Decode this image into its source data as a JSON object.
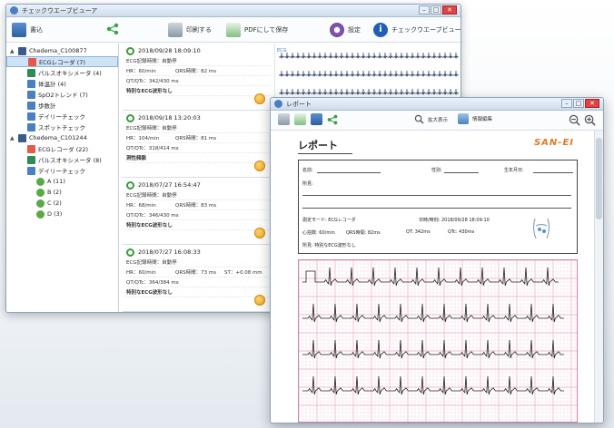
{
  "main_window": {
    "title": "チェックウエーブビューア",
    "toolbar": {
      "export_label": "書込",
      "print_label": "印刷する",
      "pdf_label": "PDFにして保存",
      "settings_label": "設定",
      "about_label": "チェックウエーブビューアについて"
    },
    "tree": [
      {
        "label": "Chedema_C100877",
        "level": 0,
        "icon": "device-icon",
        "color": "#3b5b8a"
      },
      {
        "label": "ECGレコーダ (7)",
        "level": 1,
        "icon": "ecg-icon",
        "color": "#e25a4a",
        "selected": true
      },
      {
        "label": "パルスオキシメータ (4)",
        "level": 1,
        "icon": "pulse-oximeter-icon",
        "color": "#2e8b57"
      },
      {
        "label": "体温計 (4)",
        "level": 1,
        "icon": "thermometer-icon",
        "color": "#4a7fc1"
      },
      {
        "label": "SpO2トレンド (7)",
        "level": 1,
        "icon": "trend-icon",
        "color": "#4a7fc1"
      },
      {
        "label": "歩数計",
        "level": 1,
        "icon": "pedometer-icon",
        "color": "#4a7fc1"
      },
      {
        "label": "デイリーチェック",
        "level": 1,
        "icon": "daily-check-icon",
        "color": "#4a7fc1"
      },
      {
        "label": "スポットチェック",
        "level": 1,
        "icon": "spot-check-icon",
        "color": "#4a7fc1"
      },
      {
        "label": "Chedema_C101244",
        "level": 0,
        "icon": "device-icon",
        "color": "#3b5b8a"
      },
      {
        "label": "ECGレコーダ (22)",
        "level": 1,
        "icon": "ecg-icon",
        "color": "#e25a4a"
      },
      {
        "label": "パルスオキシメータ (8)",
        "level": 1,
        "icon": "pulse-oximeter-icon",
        "color": "#2e8b57"
      },
      {
        "label": "デイリーチェック",
        "level": 1,
        "icon": "daily-check-icon",
        "color": "#4a7fc1"
      },
      {
        "label": "A (11)",
        "level": 2,
        "icon": "user-icon",
        "color": "#5aa846"
      },
      {
        "label": "B (2)",
        "level": 2,
        "icon": "user-icon",
        "color": "#5aa846"
      },
      {
        "label": "C (2)",
        "level": 2,
        "icon": "user-icon",
        "color": "#5aa846"
      },
      {
        "label": "D (3)",
        "level": 2,
        "icon": "user-icon",
        "color": "#5aa846"
      }
    ],
    "records": [
      {
        "datetime": "2018/09/28 18:09:10",
        "mode": "ECG記録時間：自動停",
        "hr": "HR：60/min",
        "qrs": "QRS時間：82 ms",
        "qtqtc": "QT/QTc：342/430 ms",
        "st": "",
        "finding": "特別なECG波形なし"
      },
      {
        "datetime": "2018/09/18 13:20:03",
        "mode": "ECG記録時間：自動停",
        "hr": "HR：104/min",
        "qrs": "QRS時間：81 ms",
        "qtqtc": "QT/QTc：318/414 ms",
        "st": "",
        "finding": "洞性頻脈"
      },
      {
        "datetime": "2018/07/27 16:54:47",
        "mode": "ECG記録時間：自動停",
        "hr": "HR：68/min",
        "qrs": "QRS時間：83 ms",
        "qtqtc": "QT/QTc：346/430 ms",
        "st": "",
        "finding": "特別なECG波形なし"
      },
      {
        "datetime": "2018/07/27 16:08:33",
        "mode": "ECG記録時間：自動停",
        "hr": "HR：60/min",
        "qrs": "QRS時間：73 ms",
        "qtqtc": "QT/QTc：364/384 ms",
        "st": "ST：+0.08 mm",
        "finding": "特別なECG波形なし"
      }
    ],
    "ecg_label": "ECG"
  },
  "report_window": {
    "title": "レポート",
    "toolbar": {
      "zoom_label": "拡大表示",
      "info_label": "情報編集"
    },
    "report": {
      "heading": "レポート",
      "brand": "SAN-EI",
      "name_label": "名前:",
      "sex_label": "性別:",
      "birth_label": "生年月日:",
      "comment_label": "所見:",
      "device_label": "測定モード: ECGレコーダ",
      "datetime_label": "日時/時刻: 2018/09/28 18:09:10",
      "hr_label": "心拍数: 60/min",
      "qrs_label": "QRS時間: 82ms",
      "qt_label": "QT: 342ms",
      "qtc_label": "QTc: 430ms",
      "finding_label": "所見: 特別なECG波形なし"
    }
  },
  "colors": {
    "accent": "#2f6fb3",
    "ecg_grid": "#f6d8e2",
    "ecg_grid_major": "#e9a9bf",
    "face": "#f0a020",
    "brand": "#e07a1f"
  }
}
